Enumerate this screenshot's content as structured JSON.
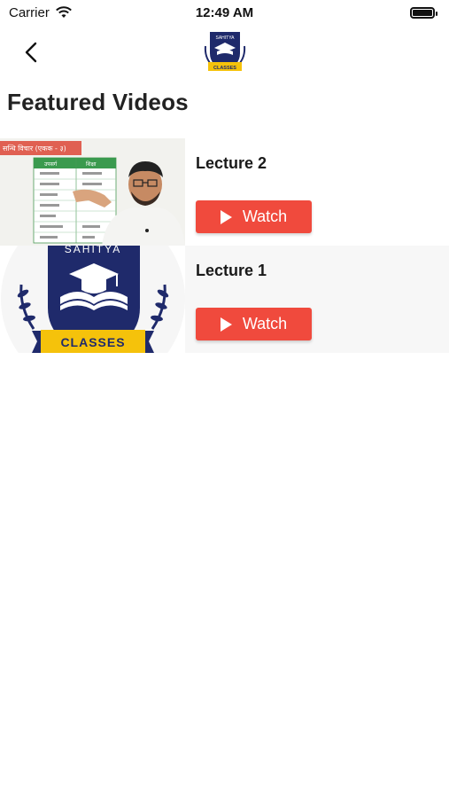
{
  "status_bar": {
    "carrier": "Carrier",
    "time": "12:49 AM"
  },
  "nav": {
    "back_icon": "chevron-left-icon",
    "logo_text": "SAHITYA",
    "logo_banner": "CLASSES"
  },
  "page": {
    "title": "Featured Videos"
  },
  "videos": [
    {
      "title": "Lecture 2",
      "watch_label": "Watch",
      "thumb": "lecture-video-frame"
    },
    {
      "title": "Lecture 1",
      "watch_label": "Watch",
      "thumb": "sahitya-classes-logo"
    }
  ],
  "thumb1": {
    "banner_text": "सन्धि विचार (एकक - ३)",
    "table_headers": [
      "उपसर्ग",
      "शिक्षा"
    ]
  },
  "thumb2": {
    "logo_text": "SAHITYA",
    "banner_text": "CLASSES"
  },
  "colors": {
    "accent": "#f04a3d",
    "navy": "#1f2a6b",
    "gold": "#f5c20b"
  }
}
